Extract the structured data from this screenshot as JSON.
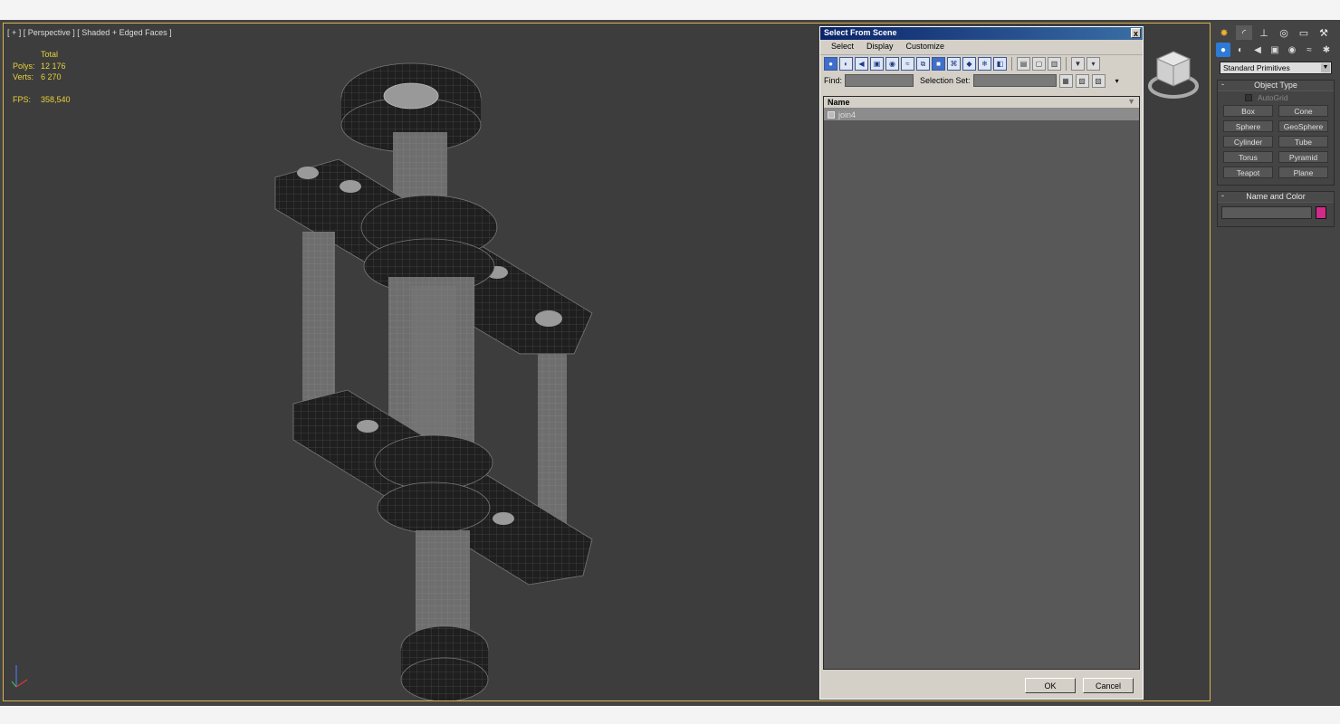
{
  "viewport": {
    "label": "[ + ] [ Perspective ] [ Shaded + Edged Faces ]",
    "stats": {
      "header": "Total",
      "polys_label": "Polys:",
      "polys_value": "12 176",
      "verts_label": "Verts:",
      "verts_value": "6 270",
      "fps_label": "FPS:",
      "fps_value": "358,540"
    }
  },
  "dialog": {
    "title": "Select From Scene",
    "close": "x",
    "menu": [
      "Select",
      "Display",
      "Customize"
    ],
    "find_label": "Find:",
    "find_value": "",
    "selection_set_label": "Selection Set:",
    "selection_set_value": "",
    "list_header": "Name",
    "rows": [
      "join4"
    ],
    "ok": "OK",
    "cancel": "Cancel"
  },
  "command_panel": {
    "dropdown": "Standard Primitives",
    "object_type_header": "Object Type",
    "autogrid": "AutoGrid",
    "primitives": [
      "Box",
      "Cone",
      "Sphere",
      "GeoSphere",
      "Cylinder",
      "Tube",
      "Torus",
      "Pyramid",
      "Teapot",
      "Plane"
    ],
    "name_color_header": "Name and Color",
    "minus": "-",
    "swatch_color": "#d12a8a"
  },
  "colors": {
    "stats_text": "#e8d23a",
    "viewport_border": "#d8b24a",
    "title_bar": "#0a246a"
  }
}
